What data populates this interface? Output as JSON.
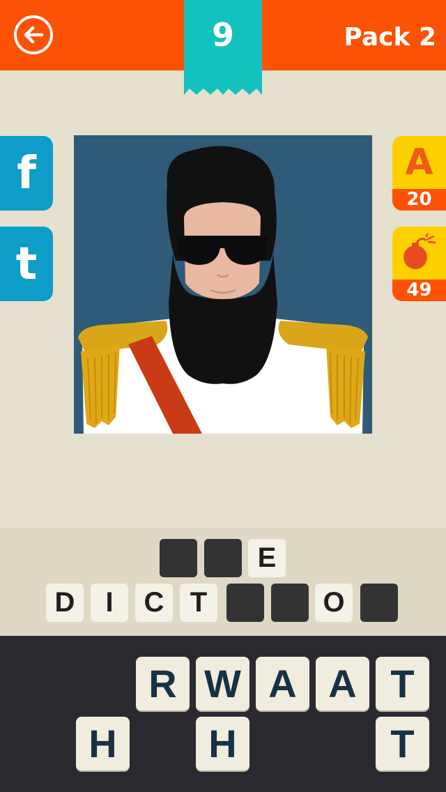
{
  "header": {
    "back_icon": "back-arrow-icon",
    "level": "9",
    "pack_title": "Pack 2"
  },
  "colors": {
    "topbar": "#fc5206",
    "ribbon": "#13c2bf",
    "background": "#e6e0cf",
    "social": "#0e9cc9",
    "hint_top": "#fed000",
    "hint_bottom": "#fb5205",
    "keyboard": "#2b2930"
  },
  "social": {
    "facebook_label": "f",
    "twitter_label": "t"
  },
  "hints": {
    "reveal_letter": {
      "icon": "letter-a-icon",
      "label": "A",
      "count": "20"
    },
    "bomb": {
      "icon": "bomb-icon",
      "count": "49"
    }
  },
  "puzzle": {
    "image": "bearded-dictator-in-white-uniform"
  },
  "answer": {
    "row1": [
      "",
      "",
      "E"
    ],
    "row2": [
      "D",
      "I",
      "C",
      "T",
      "",
      "",
      "O",
      ""
    ]
  },
  "keyboard": {
    "row1": [
      "R",
      "W",
      "A",
      "A",
      "T"
    ],
    "row2": [
      "H",
      "H",
      "T"
    ]
  }
}
